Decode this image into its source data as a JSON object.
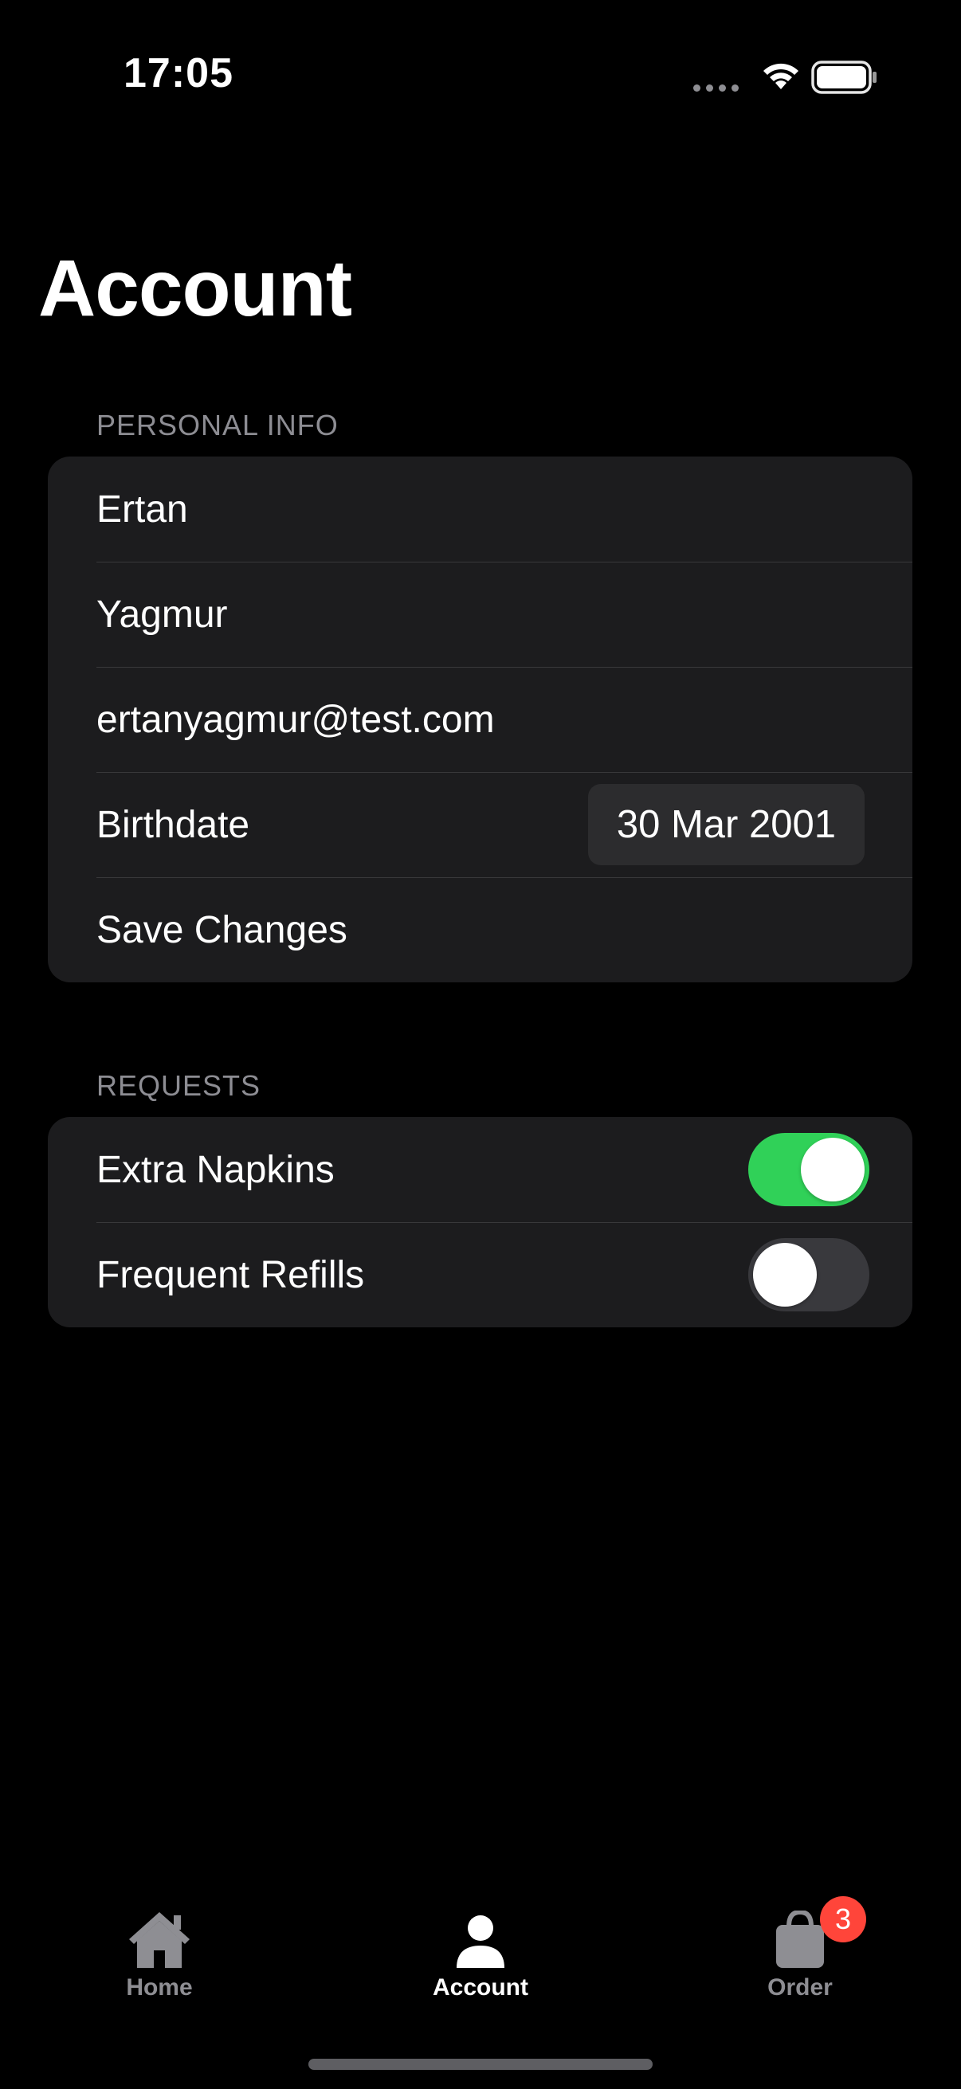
{
  "status_bar": {
    "time": "17:05"
  },
  "page_title": "Account",
  "personal_info": {
    "header": "PERSONAL INFO",
    "first_name": "Ertan",
    "last_name": "Yagmur",
    "email": "ertanyagmur@test.com",
    "birthdate_label": "Birthdate",
    "birthdate_value": "30 Mar 2001",
    "save_label": "Save Changes"
  },
  "requests": {
    "header": "REQUESTS",
    "items": [
      {
        "label": "Extra Napkins",
        "enabled": true
      },
      {
        "label": "Frequent Refills",
        "enabled": false
      }
    ]
  },
  "tab_bar": {
    "tabs": [
      {
        "label": "Home",
        "icon": "house-icon",
        "active": false
      },
      {
        "label": "Account",
        "icon": "person-icon",
        "active": true
      },
      {
        "label": "Order",
        "icon": "bag-icon",
        "active": false,
        "badge": "3"
      }
    ]
  },
  "colors": {
    "toggle_on": "#30d158",
    "badge": "#ff453a",
    "group_background": "#1c1c1e"
  }
}
